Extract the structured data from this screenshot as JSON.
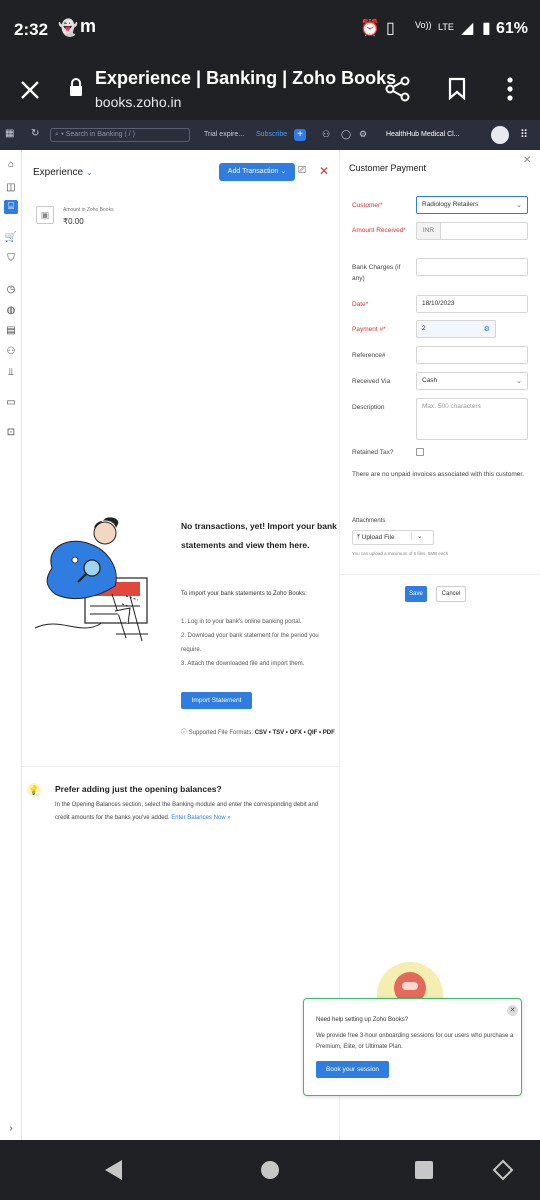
{
  "status_bar": {
    "time": "2:32",
    "network": "LTE",
    "battery": "61%"
  },
  "browser": {
    "title": "Experience | Banking | Zoho Books",
    "url": "books.zoho.in"
  },
  "appbar": {
    "search_placeholder": "Search in Banking ( / )",
    "trial": "Trial expire...",
    "subscribe": "Subscribe",
    "plus": "+",
    "org": "HealthHub Medical Cl..."
  },
  "account": {
    "name": "Experience",
    "add_transaction": "Add Transaction",
    "amount_label": "Amount in Zoho Books",
    "amount": "₹0.00"
  },
  "empty_state": {
    "title": "No transactions, yet! Import your bank statements and view them here.",
    "subtitle": "To import your bank statements to Zoho Books:",
    "step1": "1. Log in to your bank's online banking portal.",
    "step2": "2. Download your bank statement for the period you require.",
    "step3": "3. Attach the downloaded file and import them.",
    "import_button": "Import Statement",
    "formats_prefix": "Supported File Formats:",
    "formats": "CSV • TSV • OFX • QIF • PDF"
  },
  "opening_balances": {
    "title": "Prefer adding just the opening balances?",
    "body": "In the Opening Balances section, select the Banking module and enter the corresponding debit and credit amounts for the banks you've added.",
    "link": "Enter Balances Now »"
  },
  "drawer": {
    "title": "Customer Payment",
    "customer_label": "Customer*",
    "customer_value": "Radiology Retailers",
    "amount_label": "Amount Received*",
    "currency": "INR",
    "bank_charges_label": "Bank Charges (if any)",
    "date_label": "Date*",
    "date_value": "18/10/2023",
    "payment_label": "Payment #*",
    "payment_value": "2",
    "reference_label": "Reference#",
    "received_via_label": "Received Via",
    "received_via_value": "Cash",
    "description_label": "Description",
    "description_placeholder": "Max. 500 characters",
    "tax_label": "Retained Tax?",
    "note": "There are no unpaid invoices associated with this customer.",
    "attachments_label": "Attachments",
    "upload_button": "Upload File",
    "upload_hint": "You can upload a maximum of 5 files, 5MB each",
    "save": "Save",
    "cancel": "Cancel"
  },
  "popup": {
    "title": "Need help setting up Zoho Books?",
    "body": "We provide free 3-hour onboarding sessions for our users who purchase a Premium, Elite, or Ultimate Plan.",
    "button": "Book your session"
  }
}
